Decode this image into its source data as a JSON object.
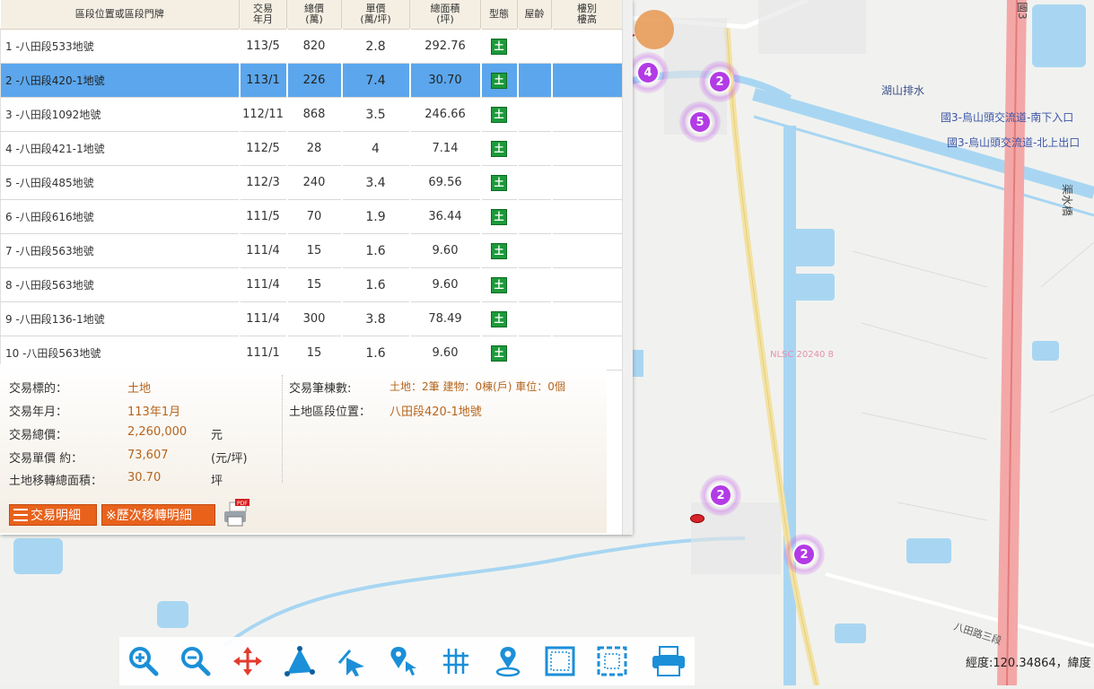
{
  "table": {
    "headers": [
      "區段位置或區段門牌",
      "交易\n年月",
      "總價\n(萬)",
      "單價\n(萬/坪)",
      "總面積\n(坪)",
      "型態",
      "屋齡",
      "樓別\n樓高"
    ],
    "rows": [
      {
        "addr": "1 -八田段533地號",
        "date": "113/5",
        "total": "820",
        "unit": "2.8",
        "area": "292.76",
        "type": "土",
        "age": "",
        "floor": "",
        "selected": false
      },
      {
        "addr": "2 -八田段420-1地號",
        "date": "113/1",
        "total": "226",
        "unit": "7.4",
        "area": "30.70",
        "type": "土",
        "age": "",
        "floor": "",
        "selected": true
      },
      {
        "addr": "3 -八田段1092地號",
        "date": "112/11",
        "total": "868",
        "unit": "3.5",
        "area": "246.66",
        "type": "土",
        "age": "",
        "floor": "",
        "selected": false
      },
      {
        "addr": "4 -八田段421-1地號",
        "date": "112/5",
        "total": "28",
        "unit": "4",
        "area": "7.14",
        "type": "土",
        "age": "",
        "floor": "",
        "selected": false
      },
      {
        "addr": "5 -八田段485地號",
        "date": "112/3",
        "total": "240",
        "unit": "3.4",
        "area": "69.56",
        "type": "土",
        "age": "",
        "floor": "",
        "selected": false
      },
      {
        "addr": "6 -八田段616地號",
        "date": "111/5",
        "total": "70",
        "unit": "1.9",
        "area": "36.44",
        "type": "土",
        "age": "",
        "floor": "",
        "selected": false
      },
      {
        "addr": "7 -八田段563地號",
        "date": "111/4",
        "total": "15",
        "unit": "1.6",
        "area": "9.60",
        "type": "土",
        "age": "",
        "floor": "",
        "selected": false
      },
      {
        "addr": "8 -八田段563地號",
        "date": "111/4",
        "total": "15",
        "unit": "1.6",
        "area": "9.60",
        "type": "土",
        "age": "",
        "floor": "",
        "selected": false
      },
      {
        "addr": "9 -八田段136-1地號",
        "date": "111/4",
        "total": "300",
        "unit": "3.8",
        "area": "78.49",
        "type": "土",
        "age": "",
        "floor": "",
        "selected": false
      },
      {
        "addr": "10 -八田段563地號",
        "date": "111/1",
        "total": "15",
        "unit": "1.6",
        "area": "9.60",
        "type": "土",
        "age": "",
        "floor": "",
        "selected": false
      }
    ]
  },
  "detail": {
    "target_label": "交易標的：",
    "target_value": "土地",
    "ym_label": "交易年月：",
    "ym_value": "113年1月",
    "total_label": "交易總價：",
    "total_value": "2,260,000",
    "total_unit": "元",
    "unit_label": "交易單價 約：",
    "unit_value": "73,607",
    "unit_unit": "(元/坪)",
    "area_label": "土地移轉總面積：",
    "area_value": "30.70",
    "area_unit": "坪",
    "count_label": "交易筆棟數:",
    "count_value": "土地：2筆 建物：0棟(戶) 車位：0個",
    "loc_label": "土地區段位置：",
    "loc_value": "八田段420-1地號"
  },
  "buttons": {
    "details": "交易明細",
    "history": "※歷次移轉明細"
  },
  "map": {
    "labels": {
      "water_channel": "湖山排水",
      "ramp_south": "國3-烏山頭交流道-南下入口",
      "ramp_north": "國3-烏山頭交流道-北上出口",
      "road_bottom": "八田路三段",
      "highway": "國3",
      "water_right": "渠水橋",
      "watermark": "NLSC 20240 8"
    },
    "clusters": [
      {
        "id": "cluster-4",
        "count": "4"
      },
      {
        "id": "cluster-2a",
        "count": "2"
      },
      {
        "id": "cluster-5",
        "count": "5"
      },
      {
        "id": "cluster-2b",
        "count": "2"
      },
      {
        "id": "cluster-2c",
        "count": "2"
      }
    ]
  },
  "toolbar": {
    "tools": [
      "zoom-in-icon",
      "zoom-out-icon",
      "pan-icon",
      "measure-area-icon",
      "select-icon",
      "locate-click-icon",
      "grid-icon",
      "location-pin-icon",
      "frame-icon",
      "frame-dashed-icon",
      "printer-icon"
    ]
  },
  "status": {
    "coords": "經度:120.34864，緯度"
  },
  "colors": {
    "selected_row": "#5ba6ec",
    "button_orange": "#e8621c",
    "cluster_purple": "#b33be6",
    "value_brown": "#b5651d"
  }
}
